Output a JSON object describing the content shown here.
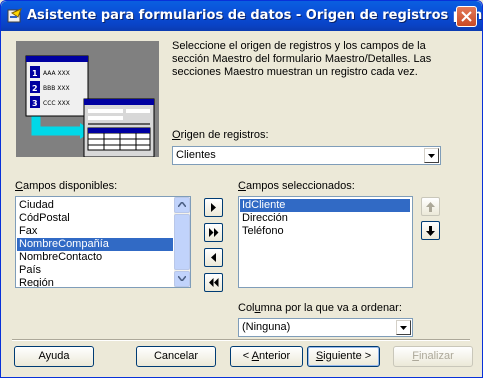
{
  "window": {
    "title": "Asistente para formularios de datos - Origen de registros principal"
  },
  "description": "Seleccione el origen de registros y los campos de la sección Maestro del formulario Maestro/Detalles. Las secciones Maestro muestran un registro cada vez.",
  "illustration": {
    "rows": [
      {
        "num": "1",
        "text": "AAA XXX"
      },
      {
        "num": "2",
        "text": "BBB XXX"
      },
      {
        "num": "3",
        "text": "CCC XXX"
      }
    ]
  },
  "record_source": {
    "label_u": "O",
    "label_rest": "rigen de registros:",
    "value": "Clientes"
  },
  "available_fields": {
    "label_u": "C",
    "label_rest": "ampos disponibles:",
    "items": [
      "Ciudad",
      "CódPostal",
      "Fax",
      "NombreCompañía",
      "NombreContacto",
      "País",
      "Región"
    ],
    "selected": "NombreCompañía"
  },
  "selected_fields": {
    "label_u": "C",
    "label_rest": "ampos seleccionados:",
    "items": [
      "IdCliente",
      "Dirección",
      "Teléfono"
    ],
    "selected": "IdCliente"
  },
  "sort": {
    "label_pre": "Col",
    "label_u": "u",
    "label_rest": "mna por la que va a ordenar:",
    "value": "(Ninguna)"
  },
  "buttons": {
    "help": "Ayuda",
    "cancel": "Cancelar",
    "back_pre": "< ",
    "back_u": "A",
    "back_rest": "nterior",
    "next_u": "S",
    "next_rest": "iguiente >",
    "finish_u": "F",
    "finish_rest": "inalizar"
  },
  "colors": {
    "titlebar": "#0a4fd8",
    "selection": "#316ac5",
    "window_bg": "#ece9d8"
  }
}
